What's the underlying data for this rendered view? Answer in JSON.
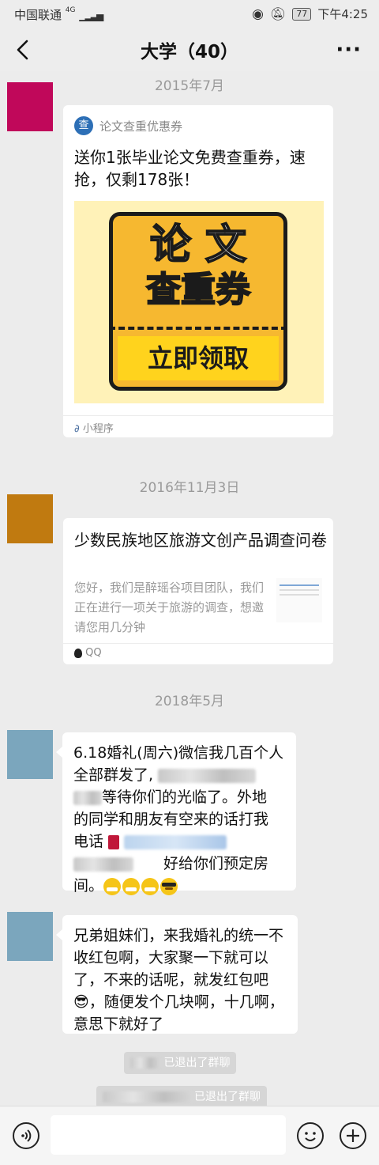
{
  "status_bar": {
    "carrier": "中国联通",
    "network": "4G",
    "battery": "77",
    "time": "下午4:25"
  },
  "nav": {
    "title": "大学（40）"
  },
  "timestamps": [
    "2015年7月",
    "2016年11月3日",
    "2018年5月"
  ],
  "avatars": {
    "colors": [
      "#c0085a",
      "#c07a10",
      "#7ba6bd",
      "#7ba6bd"
    ]
  },
  "mini_program_card": {
    "source": "论文查重优惠券",
    "source_icon": "查",
    "title": "送你1张毕业论文免费查重券，速抢，仅剩178张！",
    "image_line1": "论 文",
    "image_line2": "查重券",
    "image_button": "立即领取",
    "footer": "小程序",
    "colors": {
      "outer_bg": "#fff2b8",
      "ticket": "#f6b830",
      "ticket_border": "#1b1b1b",
      "button_bg": "#ffd31d"
    }
  },
  "qq_card": {
    "title": "少数民族地区旅游文创产品调查问卷",
    "desc": "您好，我们是醉瑶谷项目团队，我们正在进行一项关于旅游的调查，想邀请您用几分钟",
    "footer": "QQ"
  },
  "messages": [
    {
      "line1": "6.18婚礼(周六)微信我几百个人",
      "line2": "全部群发了,",
      "line3": "等待你们的光临了。外地",
      "line4": "的同学和朋友有空来的话打我",
      "line5": "电话",
      "line6": "好给你们预定房",
      "line7": "间。"
    },
    {
      "text": "兄弟姐妹们，来我婚礼的统一不收红包啊，大家聚一下就可以了，不来的话呢，就发红包吧😎，随便发个几块啊，十几啊，意思下就好了"
    }
  ],
  "system_messages": [
    "已退出了群聊",
    "已退出了群聊"
  ]
}
